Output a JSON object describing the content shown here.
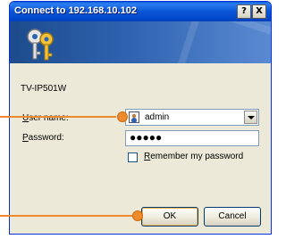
{
  "window": {
    "title": "Connect to 192.168.10.102",
    "help_button": "?",
    "close_button": "X"
  },
  "banner": {
    "icon": "keys-icon"
  },
  "device_name": "TV-IP501W",
  "user_name": {
    "label_accel": "U",
    "label_rest": "ser name:",
    "value": "admin",
    "icon": "user-icon"
  },
  "password": {
    "label_accel": "P",
    "label_rest": "assword:",
    "masked_value": "●●●●●"
  },
  "remember": {
    "label_accel": "R",
    "label_rest": "emember my password",
    "checked": false
  },
  "buttons": {
    "ok_label": "OK",
    "cancel_label": "Cancel"
  },
  "callout_color": "#ee8a2c"
}
